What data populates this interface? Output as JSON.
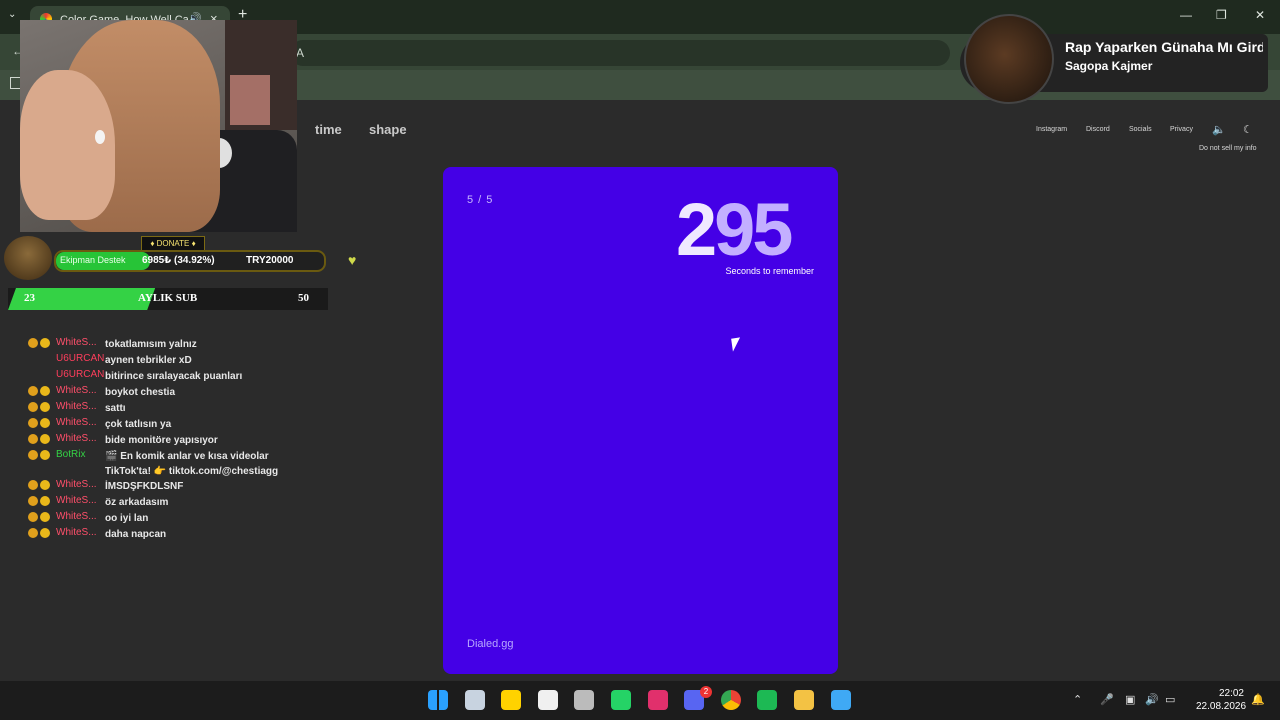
{
  "browser": {
    "tab_title": "Color Game. How Well Can You See Colors?",
    "address_partial": "A"
  },
  "donation": {
    "header": "DONATE",
    "label": "Ekipman Destek",
    "amount": "6985₺ (34.92%)",
    "goal": "TRY20000",
    "progress_fraction": 0.3492
  },
  "subgoal": {
    "current": "23",
    "label": "AYLIK SUB",
    "target": "50",
    "progress_fraction": 0.46
  },
  "chat": [
    {
      "user": "WhiteS...",
      "user_color": "#ff4f6a",
      "badges": true,
      "text": "tokatlamısım yalnız"
    },
    {
      "user": "U6URCAN",
      "user_color": "#ff3e5c",
      "badges": false,
      "text": "aynen tebrikler xD"
    },
    {
      "user": "U6URCAN",
      "user_color": "#ff3e5c",
      "badges": false,
      "text": "bitirince sıralayacak puanları"
    },
    {
      "user": "WhiteS...",
      "user_color": "#ff4f6a",
      "badges": true,
      "text": "boykot chestia"
    },
    {
      "user": "WhiteS...",
      "user_color": "#ff4f6a",
      "badges": true,
      "text": "sattı"
    },
    {
      "user": "WhiteS...",
      "user_color": "#ff4f6a",
      "badges": true,
      "text": "çok tatlısın ya"
    },
    {
      "user": "WhiteS...",
      "user_color": "#ff4f6a",
      "badges": true,
      "text": "bide monitöre yapısıyor"
    },
    {
      "user": "BotRix",
      "user_color": "#34d245",
      "badges": true,
      "text": "🎬 En komik anlar ve kısa videolar TikTok'ta! 👉 tiktok.com/@chestiagg"
    },
    {
      "user": "WhiteS...",
      "user_color": "#ff4f6a",
      "badges": true,
      "text": "İMSDŞFKDLSNF"
    },
    {
      "user": "WhiteS...",
      "user_color": "#ff4f6a",
      "badges": true,
      "text": "öz arkadasım"
    },
    {
      "user": "WhiteS...",
      "user_color": "#ff4f6a",
      "badges": true,
      "text": "oo iyi lan"
    },
    {
      "user": "WhiteS...",
      "user_color": "#ff4f6a",
      "badges": true,
      "text": "daha napcan"
    }
  ],
  "site": {
    "nav": [
      "time",
      "shape"
    ],
    "links": [
      "Instagram",
      "Discord",
      "Socials",
      "Privacy"
    ],
    "do_not_sell": "Do not sell my info",
    "accent_color": "#4400e6"
  },
  "game": {
    "round": "5 / 5",
    "timer_digit1": "2",
    "timer_digits_rest": "95",
    "timer_caption": "Seconds to remember",
    "brand": "Dialed.gg"
  },
  "now_playing": {
    "song": "Rap Yaparken Günaha Mı Girdim",
    "artist": "Sagopa Kajmer"
  },
  "taskbar": {
    "icons": [
      "windows-start-icon",
      "steam-icon",
      "sticky-notes-icon",
      "snipping-tool-icon",
      "obs-icon",
      "whatsapp-icon",
      "instagram-icon",
      "discord-icon",
      "chrome-icon",
      "spotify-icon",
      "file-explorer-icon",
      "app-icon"
    ],
    "discord_badge": "2",
    "time": "22:02",
    "date": "22.08.2026"
  }
}
